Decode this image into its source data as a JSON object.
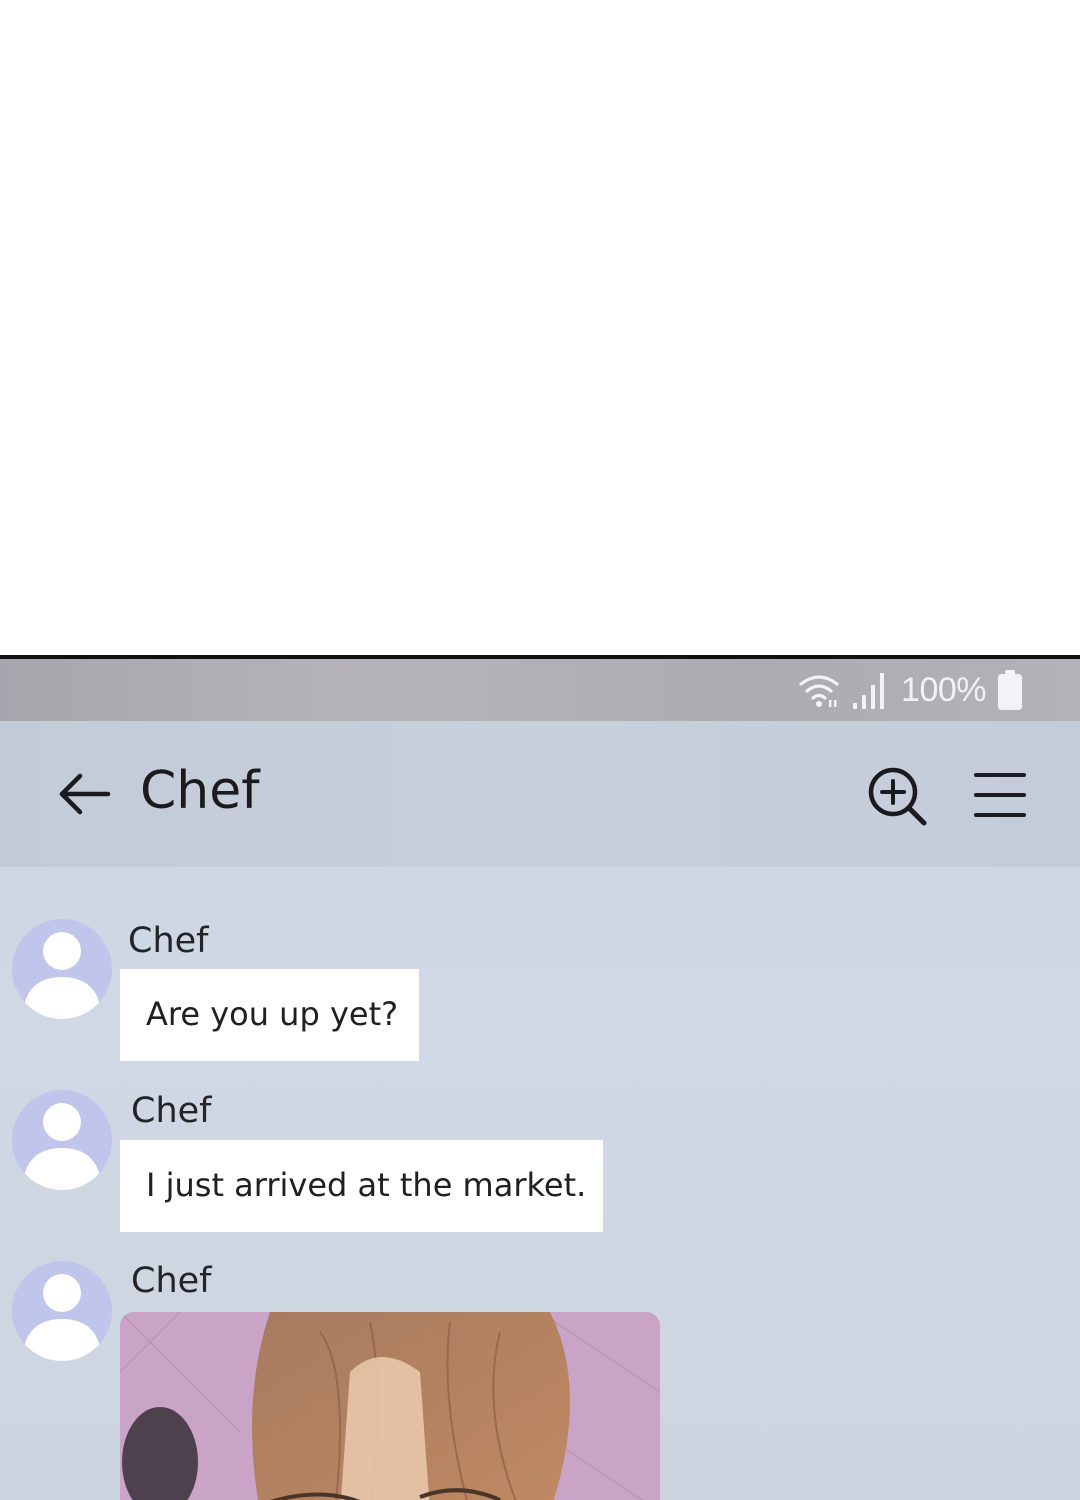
{
  "status_bar": {
    "wifi_icon": "wifi-icon",
    "signal_icon": "signal-bars-icon",
    "battery_percent": "100%",
    "battery_icon": "battery-full-icon"
  },
  "header": {
    "back_icon": "arrow-left-icon",
    "title": "Chef",
    "zoom_icon": "zoom-in-icon",
    "menu_icon": "hamburger-menu-icon"
  },
  "messages": [
    {
      "sender": "Chef",
      "text": "Are you up yet?"
    },
    {
      "sender": "Chef",
      "text": "I just arrived at the market."
    },
    {
      "sender": "Chef",
      "attachment": "photo"
    }
  ],
  "colors": {
    "chat_background": "#cfd8e4",
    "status_bar": "#aeadb3",
    "bubble": "#ffffff",
    "avatar_bg": "#c0c5ec",
    "avatar_figure": "#ffffff"
  }
}
